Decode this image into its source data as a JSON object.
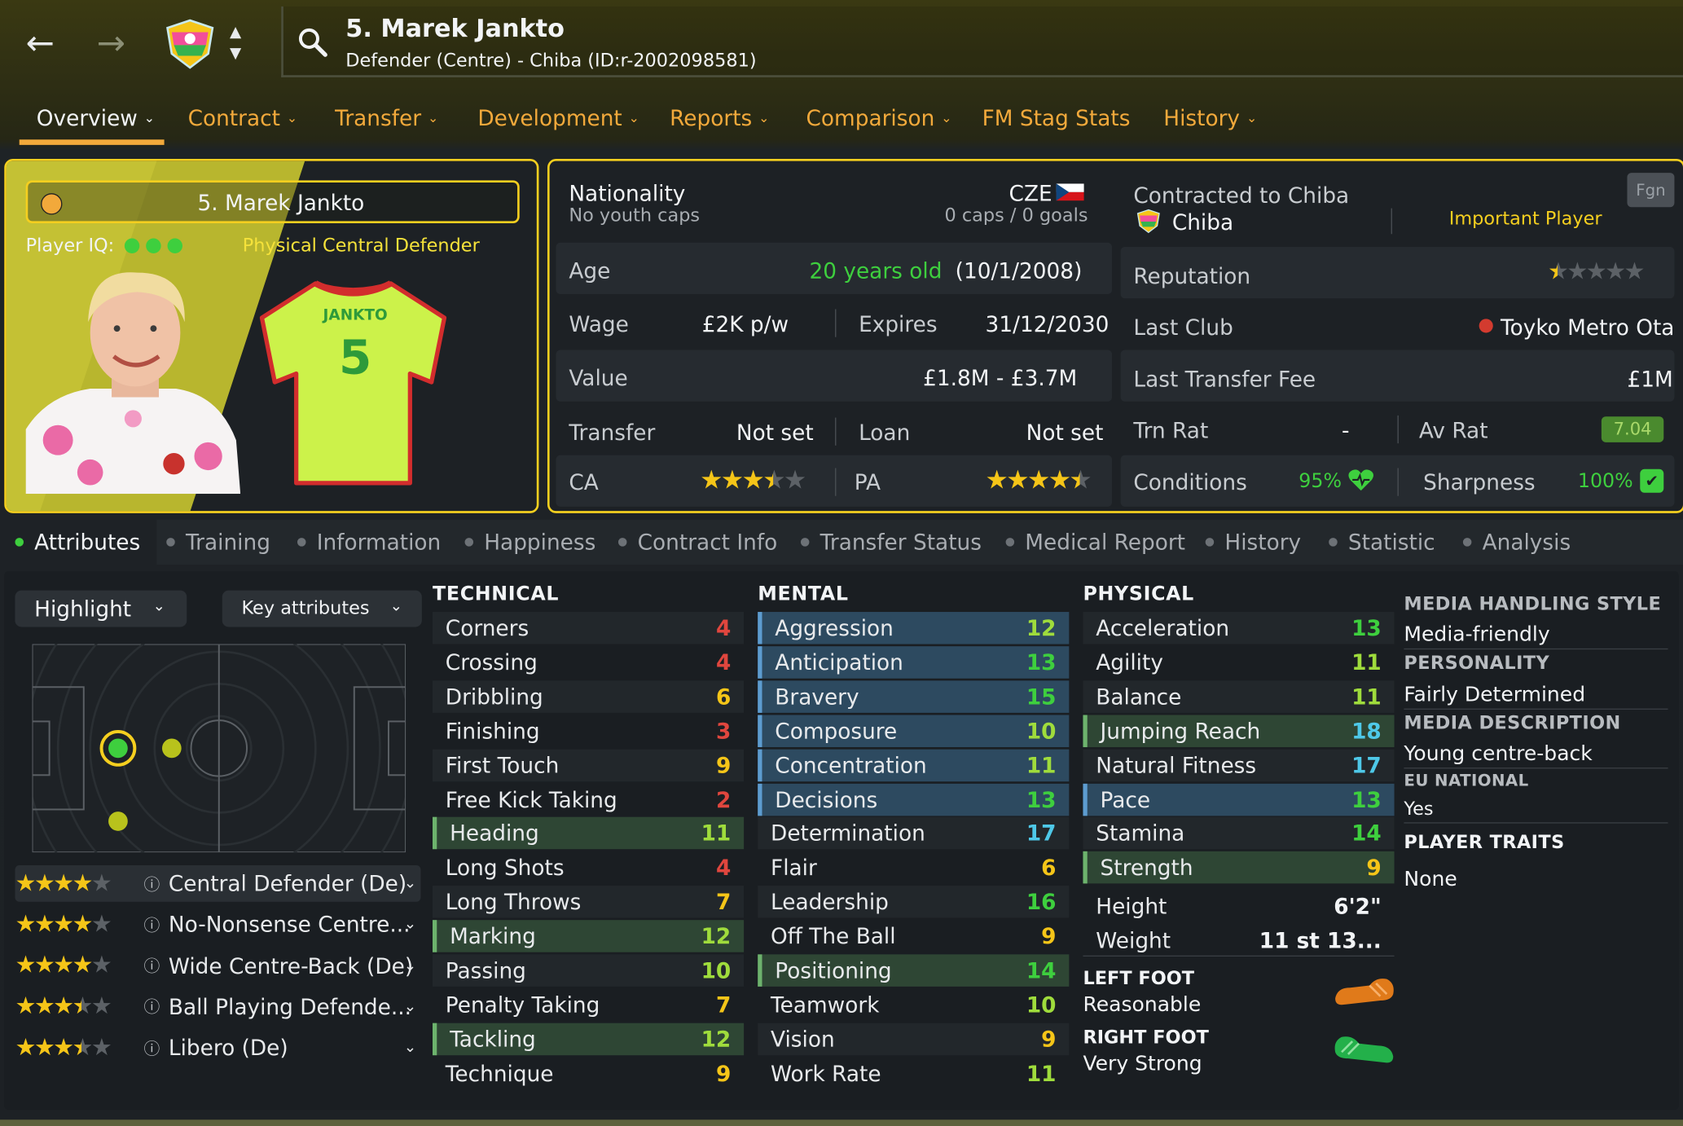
{
  "header": {
    "back_icon": "arrow-left-icon",
    "forward_icon": "arrow-right-icon",
    "search_icon": "search-icon",
    "player_title": "5. Marek Jankto",
    "player_subtitle": "Defender (Centre) - Chiba (ID:r-2002098581)"
  },
  "tabs": [
    {
      "label": "Overview"
    },
    {
      "label": "Contract"
    },
    {
      "label": "Transfer"
    },
    {
      "label": "Development"
    },
    {
      "label": "Reports"
    },
    {
      "label": "Comparison"
    },
    {
      "label": "FM Stag Stats"
    },
    {
      "label": "History"
    }
  ],
  "card": {
    "name": "5. Marek Jankto",
    "iq_label": "Player IQ:",
    "role_label": "Physical Central Defender",
    "shirt_name": "JANKTO",
    "shirt_number": "5"
  },
  "info": {
    "nationality_label": "Nationality",
    "nationality_value": "CZE",
    "youth_caps": "No youth caps",
    "caps_goals": "0 caps / 0 goals",
    "age_label": "Age",
    "age_value": "20 years old",
    "dob": "(10/1/2008)",
    "wage_label": "Wage",
    "wage_value": "£2K p/w",
    "expires_label": "Expires",
    "expires_value": "31/12/2030",
    "value_label": "Value",
    "value_value": "£1.8M - £3.7M",
    "transfer_label": "Transfer",
    "transfer_value": "Not set",
    "loan_label": "Loan",
    "loan_value": "Not set",
    "ca_label": "CA",
    "ca_stars": 3.5,
    "pa_label": "PA",
    "pa_stars": 4.5
  },
  "contract": {
    "contracted_label": "Contracted to Chiba",
    "club": "Chiba",
    "status": "Important Player",
    "fgn_button": "Fgn",
    "reputation_label": "Reputation",
    "reputation_stars": 0.5,
    "last_club_label": "Last Club",
    "last_club_value": "Toyko Metro Ota",
    "fee_label": "Last Transfer Fee",
    "fee_value": "£1M",
    "trn_rat_label": "Trn Rat",
    "trn_rat_value": "-",
    "av_rat_label": "Av Rat",
    "av_rat_value": "7.04",
    "conditions_label": "Conditions",
    "conditions_value": "95%",
    "sharpness_label": "Sharpness",
    "sharpness_value": "100%"
  },
  "subtabs": [
    {
      "label": "Attributes"
    },
    {
      "label": "Training"
    },
    {
      "label": "Information"
    },
    {
      "label": "Happiness"
    },
    {
      "label": "Contract Info"
    },
    {
      "label": "Transfer Status"
    },
    {
      "label": "Medical Report"
    },
    {
      "label": "History"
    },
    {
      "label": "Statistic"
    },
    {
      "label": "Analysis"
    }
  ],
  "controls": {
    "highlight": "Highlight",
    "key_attributes": "Key attributes"
  },
  "roles": [
    {
      "name": "Central Defender (De)",
      "stars": 4
    },
    {
      "name": "No-Nonsense Centre...",
      "stars": 4
    },
    {
      "name": "Wide Centre-Back (De)",
      "stars": 4
    },
    {
      "name": "Ball Playing Defende...",
      "stars": 3.5
    },
    {
      "name": "Libero (De)",
      "stars": 3.5
    }
  ],
  "technical": {
    "title": "TECHNICAL",
    "items": [
      {
        "name": "Corners",
        "value": "4",
        "hl": "plain"
      },
      {
        "name": "Crossing",
        "value": "4",
        "hl": "plain"
      },
      {
        "name": "Dribbling",
        "value": "6",
        "hl": "plain"
      },
      {
        "name": "Finishing",
        "value": "3",
        "hl": "plain"
      },
      {
        "name": "First Touch",
        "value": "9",
        "hl": "plain"
      },
      {
        "name": "Free Kick Taking",
        "value": "2",
        "hl": "plain"
      },
      {
        "name": "Heading",
        "value": "11",
        "hl": "green"
      },
      {
        "name": "Long Shots",
        "value": "4",
        "hl": "plain"
      },
      {
        "name": "Long Throws",
        "value": "7",
        "hl": "plain"
      },
      {
        "name": "Marking",
        "value": "12",
        "hl": "green"
      },
      {
        "name": "Passing",
        "value": "10",
        "hl": "plain"
      },
      {
        "name": "Penalty Taking",
        "value": "7",
        "hl": "plain"
      },
      {
        "name": "Tackling",
        "value": "12",
        "hl": "green"
      },
      {
        "name": "Technique",
        "value": "9",
        "hl": "plain"
      }
    ]
  },
  "mental": {
    "title": "MENTAL",
    "items": [
      {
        "name": "Aggression",
        "value": "12",
        "hl": "blue"
      },
      {
        "name": "Anticipation",
        "value": "13",
        "hl": "blue"
      },
      {
        "name": "Bravery",
        "value": "15",
        "hl": "blue"
      },
      {
        "name": "Composure",
        "value": "10",
        "hl": "blue"
      },
      {
        "name": "Concentration",
        "value": "11",
        "hl": "blue"
      },
      {
        "name": "Decisions",
        "value": "13",
        "hl": "blue"
      },
      {
        "name": "Determination",
        "value": "17",
        "hl": "plain"
      },
      {
        "name": "Flair",
        "value": "6",
        "hl": "plain"
      },
      {
        "name": "Leadership",
        "value": "16",
        "hl": "plain"
      },
      {
        "name": "Off The Ball",
        "value": "9",
        "hl": "plain"
      },
      {
        "name": "Positioning",
        "value": "14",
        "hl": "green"
      },
      {
        "name": "Teamwork",
        "value": "10",
        "hl": "plain"
      },
      {
        "name": "Vision",
        "value": "9",
        "hl": "plain"
      },
      {
        "name": "Work Rate",
        "value": "11",
        "hl": "plain"
      }
    ]
  },
  "physical": {
    "title": "PHYSICAL",
    "items": [
      {
        "name": "Acceleration",
        "value": "13",
        "hl": "plain"
      },
      {
        "name": "Agility",
        "value": "11",
        "hl": "plain"
      },
      {
        "name": "Balance",
        "value": "11",
        "hl": "plain"
      },
      {
        "name": "Jumping Reach",
        "value": "18",
        "hl": "green"
      },
      {
        "name": "Natural Fitness",
        "value": "17",
        "hl": "plain"
      },
      {
        "name": "Pace",
        "value": "13",
        "hl": "blue"
      },
      {
        "name": "Stamina",
        "value": "14",
        "hl": "plain"
      },
      {
        "name": "Strength",
        "value": "9",
        "hl": "green"
      }
    ],
    "height_label": "Height",
    "height_value": "6'2\"",
    "weight_label": "Weight",
    "weight_value": "11 st 13...",
    "left_foot_label": "LEFT FOOT",
    "left_foot_value": "Reasonable",
    "right_foot_label": "RIGHT FOOT",
    "right_foot_value": "Very Strong"
  },
  "side": {
    "media_style_label": "MEDIA HANDLING STYLE",
    "media_style_value": "Media-friendly",
    "personality_label": "PERSONALITY",
    "personality_value": "Fairly Determined",
    "media_desc_label": "MEDIA DESCRIPTION",
    "media_desc_value": "Young centre-back",
    "eu_label": "EU NATIONAL",
    "eu_value": "Yes",
    "traits_label": "PLAYER TRAITS",
    "traits_value": "None"
  },
  "colors": {
    "accent": "#f5cf1f",
    "tab_orange": "#f2a93b",
    "green_value": "#3ecf3e",
    "red_value": "#e0463e",
    "yellow_value": "#f5c518",
    "cyan_value": "#4ec8e8"
  }
}
